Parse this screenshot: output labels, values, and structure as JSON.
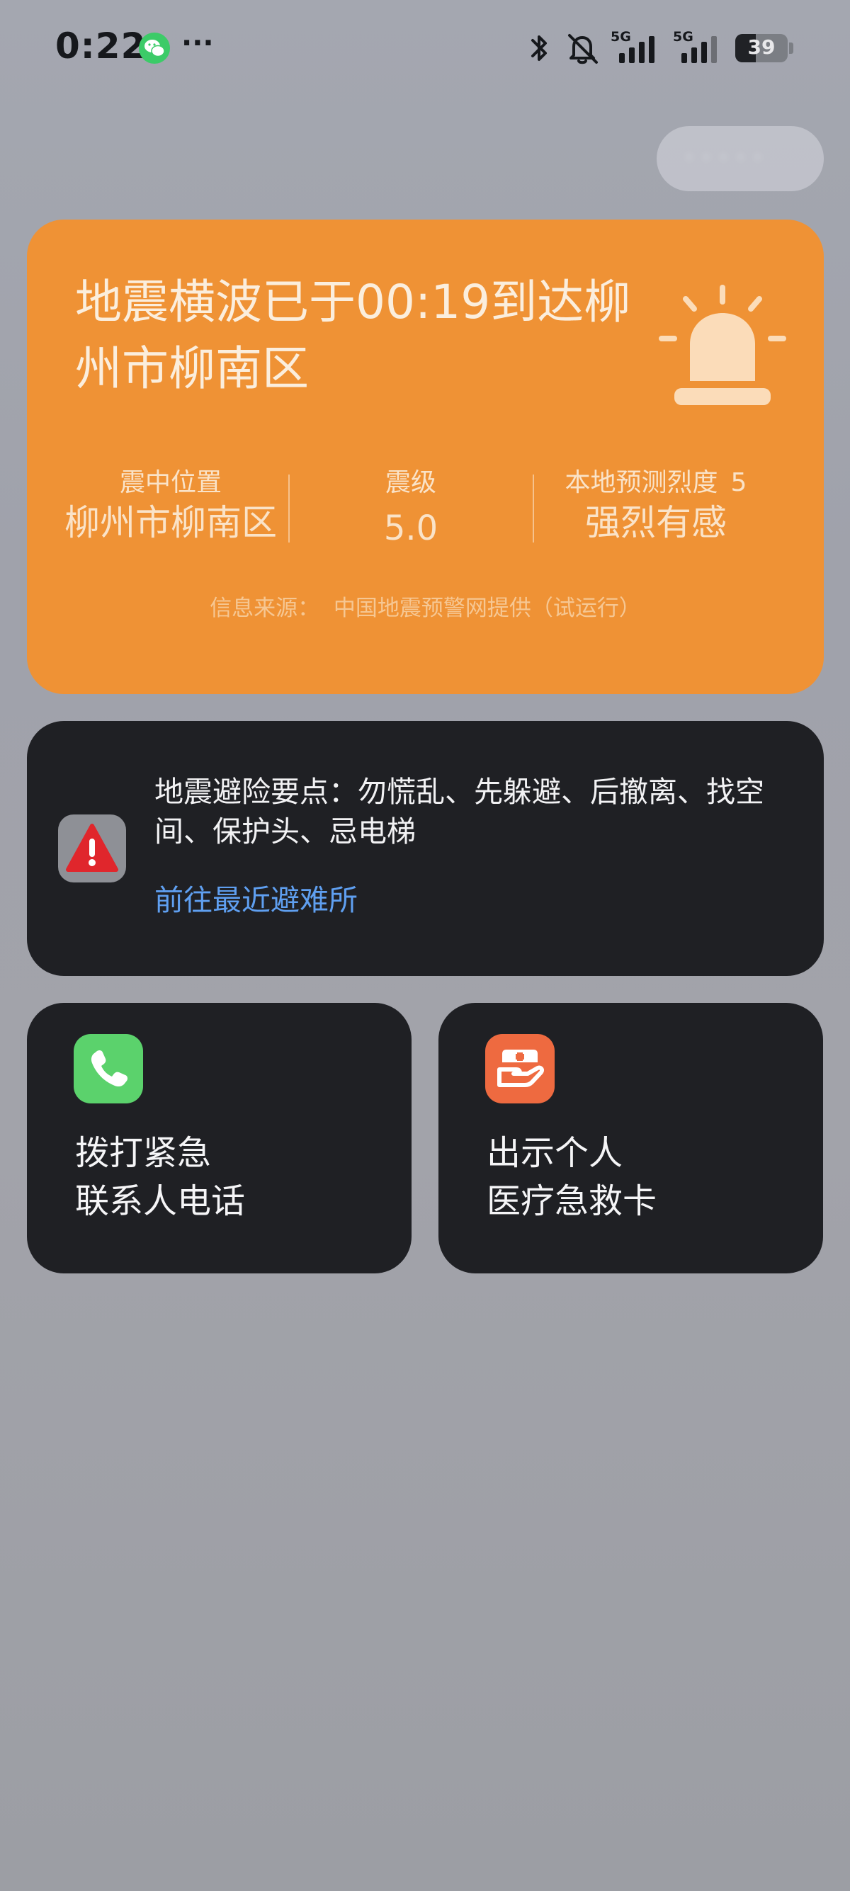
{
  "status_bar": {
    "time": "0:22",
    "more": "···",
    "wechat_icon": "wechat-icon",
    "bluetooth_icon": "bluetooth-icon",
    "mute_icon": "bell-muted-icon",
    "signal_1_tag": "5G",
    "signal_2_tag": "5G",
    "battery_level": "39",
    "battery_fraction": 0.39
  },
  "top_pill": {
    "text": "· · · · ·"
  },
  "alert": {
    "title": "地震横波已于00:19到达柳州市柳南区",
    "icon": "siren-icon",
    "color": "#ef9235",
    "epicenter_label": "震中位置",
    "epicenter_value": "柳州市柳南区",
    "magnitude_label": "震级",
    "magnitude_value": "5.0",
    "intensity_label": "本地预测烈度",
    "intensity_number": "5",
    "intensity_value": "强烈有感",
    "source": "信息来源：  中国地震预警网提供（试运行）"
  },
  "tips": {
    "icon": "warning-triangle-icon",
    "text": "地震避险要点：勿慌乱、先躲避、后撤离、找空间、保护头、忌电梯",
    "link": "前往最近避难所",
    "link_color": "#5f9ff0"
  },
  "actions": [
    {
      "icon": "phone-icon",
      "line1": "拨打紧急",
      "line2": "联系人电话",
      "color": "#5bd26c"
    },
    {
      "icon": "medical-card-icon",
      "line1": "出示个人",
      "line2": "医疗急救卡",
      "color": "#ee6a40"
    }
  ]
}
